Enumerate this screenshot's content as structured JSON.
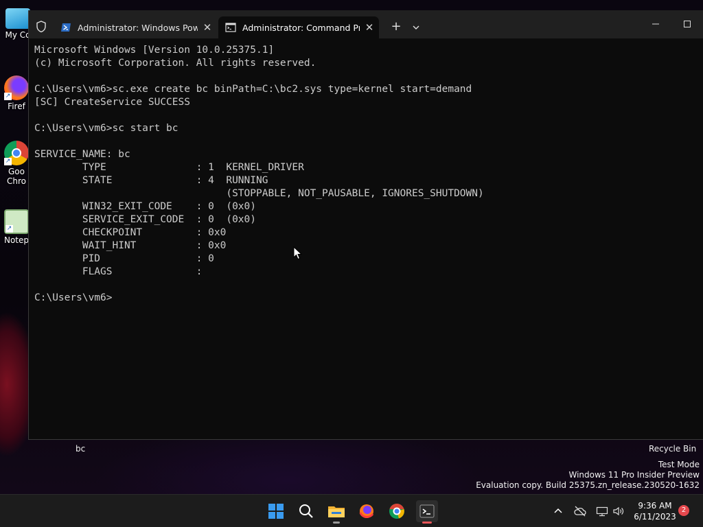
{
  "desktop": {
    "icons": [
      {
        "label": "My Co",
        "icon": "computer-icon"
      },
      {
        "label": "Firef",
        "icon": "firefox-icon"
      },
      {
        "label": "Goo Chro",
        "icon": "chrome-icon"
      },
      {
        "label": "Notep",
        "icon": "notepad-icon"
      }
    ],
    "selected_label": "bc",
    "recycle_bin_label": "Recycle Bin",
    "watermark": {
      "line1": "Test Mode",
      "line2": "Windows 11 Pro Insider Preview",
      "line3": "Evaluation copy. Build 25375.zn_release.230520-1632"
    }
  },
  "terminal": {
    "tabs": [
      {
        "title": "Administrator: Windows Power",
        "icon": "powershell-icon",
        "active": false
      },
      {
        "title": "Administrator:  Command Pro",
        "icon": "cmd-icon",
        "active": true
      }
    ],
    "new_tab_symbol": "+",
    "dropdown_symbol": "⌄",
    "minimize_symbol": "—",
    "lines": [
      "Microsoft Windows [Version 10.0.25375.1]",
      "(c) Microsoft Corporation. All rights reserved.",
      "",
      "C:\\Users\\vm6>sc.exe create bc binPath=C:\\bc2.sys type=kernel start=demand",
      "[SC] CreateService SUCCESS",
      "",
      "C:\\Users\\vm6>sc start bc",
      "",
      "SERVICE_NAME: bc",
      "        TYPE               : 1  KERNEL_DRIVER",
      "        STATE              : 4  RUNNING",
      "                                (STOPPABLE, NOT_PAUSABLE, IGNORES_SHUTDOWN)",
      "        WIN32_EXIT_CODE    : 0  (0x0)",
      "        SERVICE_EXIT_CODE  : 0  (0x0)",
      "        CHECKPOINT         : 0x0",
      "        WAIT_HINT          : 0x0",
      "        PID                : 0",
      "        FLAGS              :",
      "",
      "C:\\Users\\vm6>"
    ]
  },
  "taskbar": {
    "apps": [
      "start-icon",
      "search-icon",
      "file-explorer-icon",
      "firefox-icon",
      "chrome-icon",
      "terminal-icon"
    ],
    "clock": {
      "time": "9:36 AM",
      "date": "6/11/2023"
    },
    "notification_count": "2",
    "tray_chevron": "^"
  },
  "colors": {
    "terminal_bg": "#0c0c0c",
    "titlebar_bg": "#202020",
    "text": "#cccccc",
    "taskbar_bg": "#1c1c1c",
    "accent": "#e8565a"
  }
}
